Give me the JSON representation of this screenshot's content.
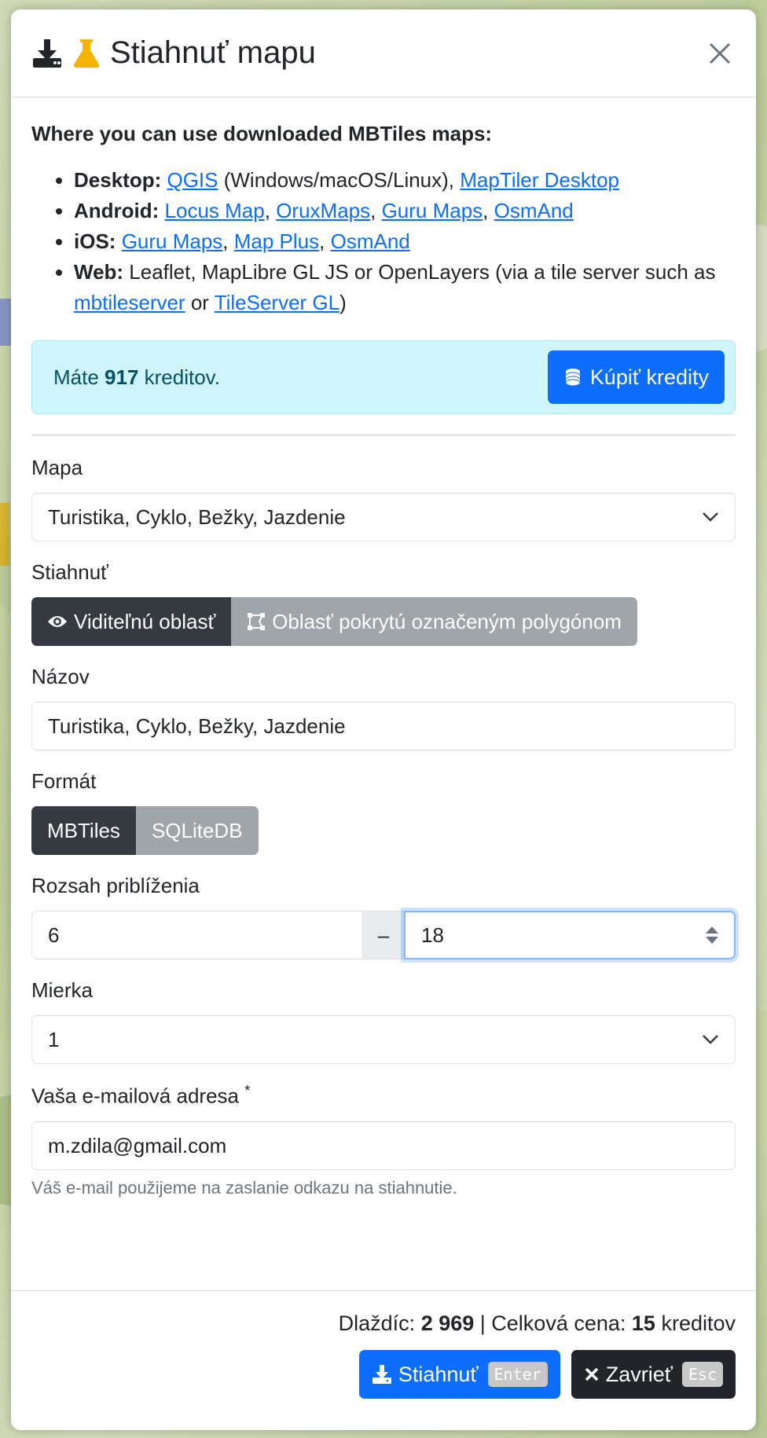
{
  "header": {
    "title": "Stiahnuť mapu",
    "icons": [
      "download-icon",
      "flask-icon"
    ],
    "close_icon": "close-icon"
  },
  "intro": {
    "heading": "Where you can use downloaded MBTiles maps:",
    "items": [
      {
        "label": "Desktop:",
        "links": [
          "QGIS",
          "MapTiler Desktop"
        ],
        "text": " (Windows/macOS/Linux), "
      },
      {
        "label": "Android:",
        "links": [
          "Locus Map",
          "OruxMaps",
          "Guru Maps",
          "OsmAnd"
        ]
      },
      {
        "label": "iOS:",
        "links": [
          "Guru Maps",
          "Map Plus",
          "OsmAnd"
        ]
      },
      {
        "label": "Web:",
        "text_before": " Leaflet, MapLibre GL JS or OpenLayers (via a tile server such as ",
        "links": [
          "mbtileserver",
          "TileServer GL"
        ],
        "or": " or ",
        "text_after": ")"
      }
    ]
  },
  "credits": {
    "prefix": "Máte ",
    "amount": "917",
    "suffix": " kreditov.",
    "buy_label": "Kúpiť kredity"
  },
  "form": {
    "map_label": "Mapa",
    "map_value": "Turistika, Cyklo, Bežky, Jazdenie",
    "download_label": "Stiahnuť",
    "download_options": [
      "Viditeľnú oblasť",
      "Oblasť pokrytú označeným polygónom"
    ],
    "download_selected": "Viditeľnú oblasť",
    "name_label": "Názov",
    "name_value": "Turistika, Cyklo, Bežky, Jazdenie",
    "format_label": "Formát",
    "format_options": [
      "MBTiles",
      "SQLiteDB"
    ],
    "format_selected": "MBTiles",
    "zoom_label": "Rozsah priblíženia",
    "zoom_min": "6",
    "zoom_sep": "–",
    "zoom_max": "18",
    "scale_label": "Mierka",
    "scale_value": "1",
    "email_label": "Vaša e-mailová adresa",
    "email_required": "*",
    "email_value": "m.zdila@gmail.com",
    "email_help": "Váš e-mail použijeme na zaslanie odkazu na stiahnutie."
  },
  "footer": {
    "tiles_label": "Dlaždíc: ",
    "tiles_value": "2 969",
    "divider": " | ",
    "price_label": "Celková cena: ",
    "price_value": "15",
    "price_unit": " kreditov",
    "download_label": "Stiahnuť",
    "download_kbd": "Enter",
    "close_label": "Zavrieť",
    "close_kbd": "Esc"
  },
  "colors": {
    "primary": "#0d6efd",
    "dark": "#212529",
    "info_bg": "#cff4fc",
    "flask": "#f5b400"
  }
}
